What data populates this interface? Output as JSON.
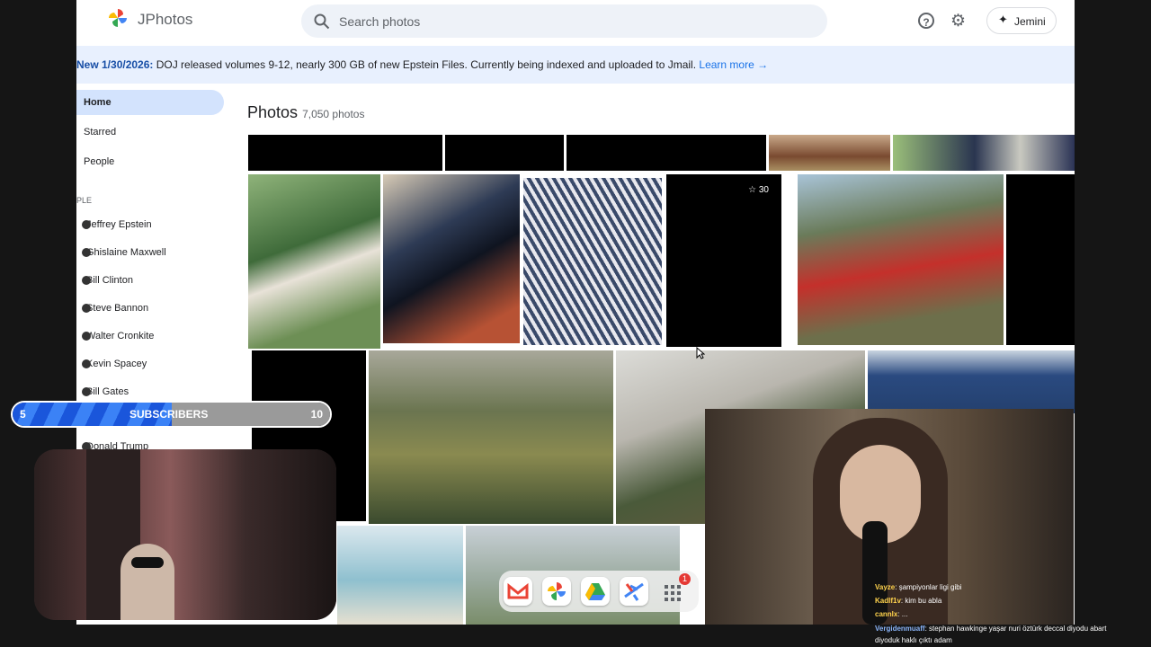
{
  "app": {
    "name": "JPhotos"
  },
  "header": {
    "search_placeholder": "Search photos",
    "jemini_label": "Jemini"
  },
  "banner": {
    "date": "New 1/30/2026:",
    "text": " DOJ released volumes 9-12, nearly 300 GB of new Epstein Files. Currently being indexed and uploaded to Jmail.",
    "link": "Learn more →"
  },
  "sidebar": {
    "nav": [
      "Home",
      "Starred",
      "People"
    ],
    "section_label": "PLE",
    "people": [
      "Jeffrey Epstein",
      "Ghislaine Maxwell",
      "Bill Clinton",
      "Steve Bannon",
      "Walter Cronkite",
      "Kevin Spacey",
      "Bill Gates",
      "Donald Trump"
    ]
  },
  "main": {
    "title": "Photos",
    "count": "7,050 photos",
    "star_count": "30"
  },
  "subscribers": {
    "left": "5",
    "label": "SUBSCRIBERS",
    "right": "10",
    "progress": 0.5
  },
  "dock": {
    "badge": "1",
    "apps": [
      "gmail-icon",
      "photos-icon",
      "drive-icon",
      "flights-icon",
      "apps-grid-icon"
    ]
  },
  "chat": [
    {
      "user": "Vayze",
      "msg": ": şampiyonlar ligi gibi"
    },
    {
      "user": "Kadlf1v",
      "msg": ": kim bu abla"
    },
    {
      "user": "cannlx",
      "msg": ": ..."
    },
    {
      "user": "Vergidenmuaff",
      "msg": ": stephan hawkinge yaşar nuri öztürk deccal diyodu abart"
    },
    {
      "user": "",
      "msg": "diyoduk haklı çıktı adam"
    }
  ],
  "colors": {
    "accent": "#1a73e8",
    "banner_bg": "#e8f0fe",
    "nav_active": "#d3e3fd"
  }
}
